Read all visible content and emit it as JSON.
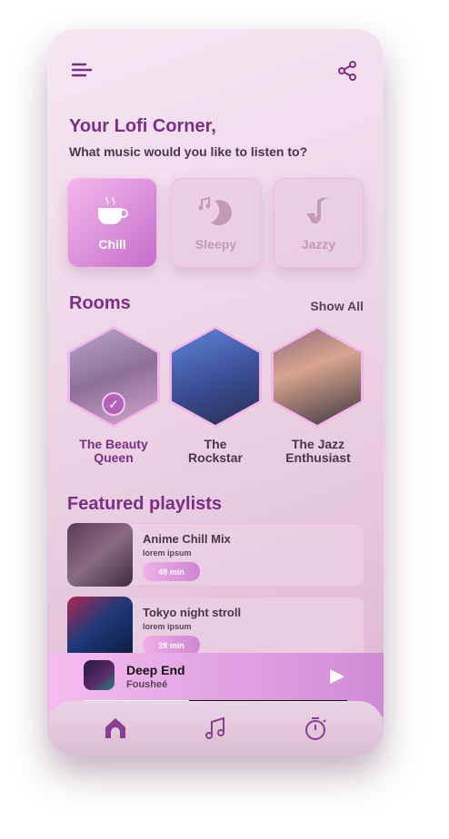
{
  "header": {
    "menu_icon": "hamburger-icon",
    "share_icon": "share-icon"
  },
  "greeting": {
    "title": "Your Lofi Corner,",
    "subtitle": "What music would you like to listen to?"
  },
  "moods": [
    {
      "label": "Chill",
      "icon": "coffee-cup-icon",
      "active": true
    },
    {
      "label": "Sleepy",
      "icon": "moon-music-icon",
      "active": false
    },
    {
      "label": "Jazzy",
      "icon": "saxophone-icon",
      "active": false
    }
  ],
  "rooms": {
    "title": "Rooms",
    "show_all": "Show All",
    "items": [
      {
        "label": "The Beauty Queen",
        "selected": true
      },
      {
        "label": "The Rockstar",
        "selected": false
      },
      {
        "label": "The Jazz Enthusiast",
        "selected": false
      }
    ]
  },
  "playlists": {
    "title": "Featured playlists",
    "items": [
      {
        "title": "Anime Chill Mix",
        "subtitle": "lorem ipsum",
        "duration": "49 min"
      },
      {
        "title": "Tokyo night stroll",
        "subtitle": "lorem ipsum",
        "duration": "28 min"
      }
    ]
  },
  "player": {
    "track": "Deep End",
    "artist": "Fousheé",
    "progress": 0.4
  },
  "nav": [
    "home-icon",
    "music-note-icon",
    "timer-icon"
  ],
  "colors": {
    "accent": "#7a2f87",
    "active_gradient_start": "#f3b6ea",
    "active_gradient_end": "#c46fcb"
  }
}
